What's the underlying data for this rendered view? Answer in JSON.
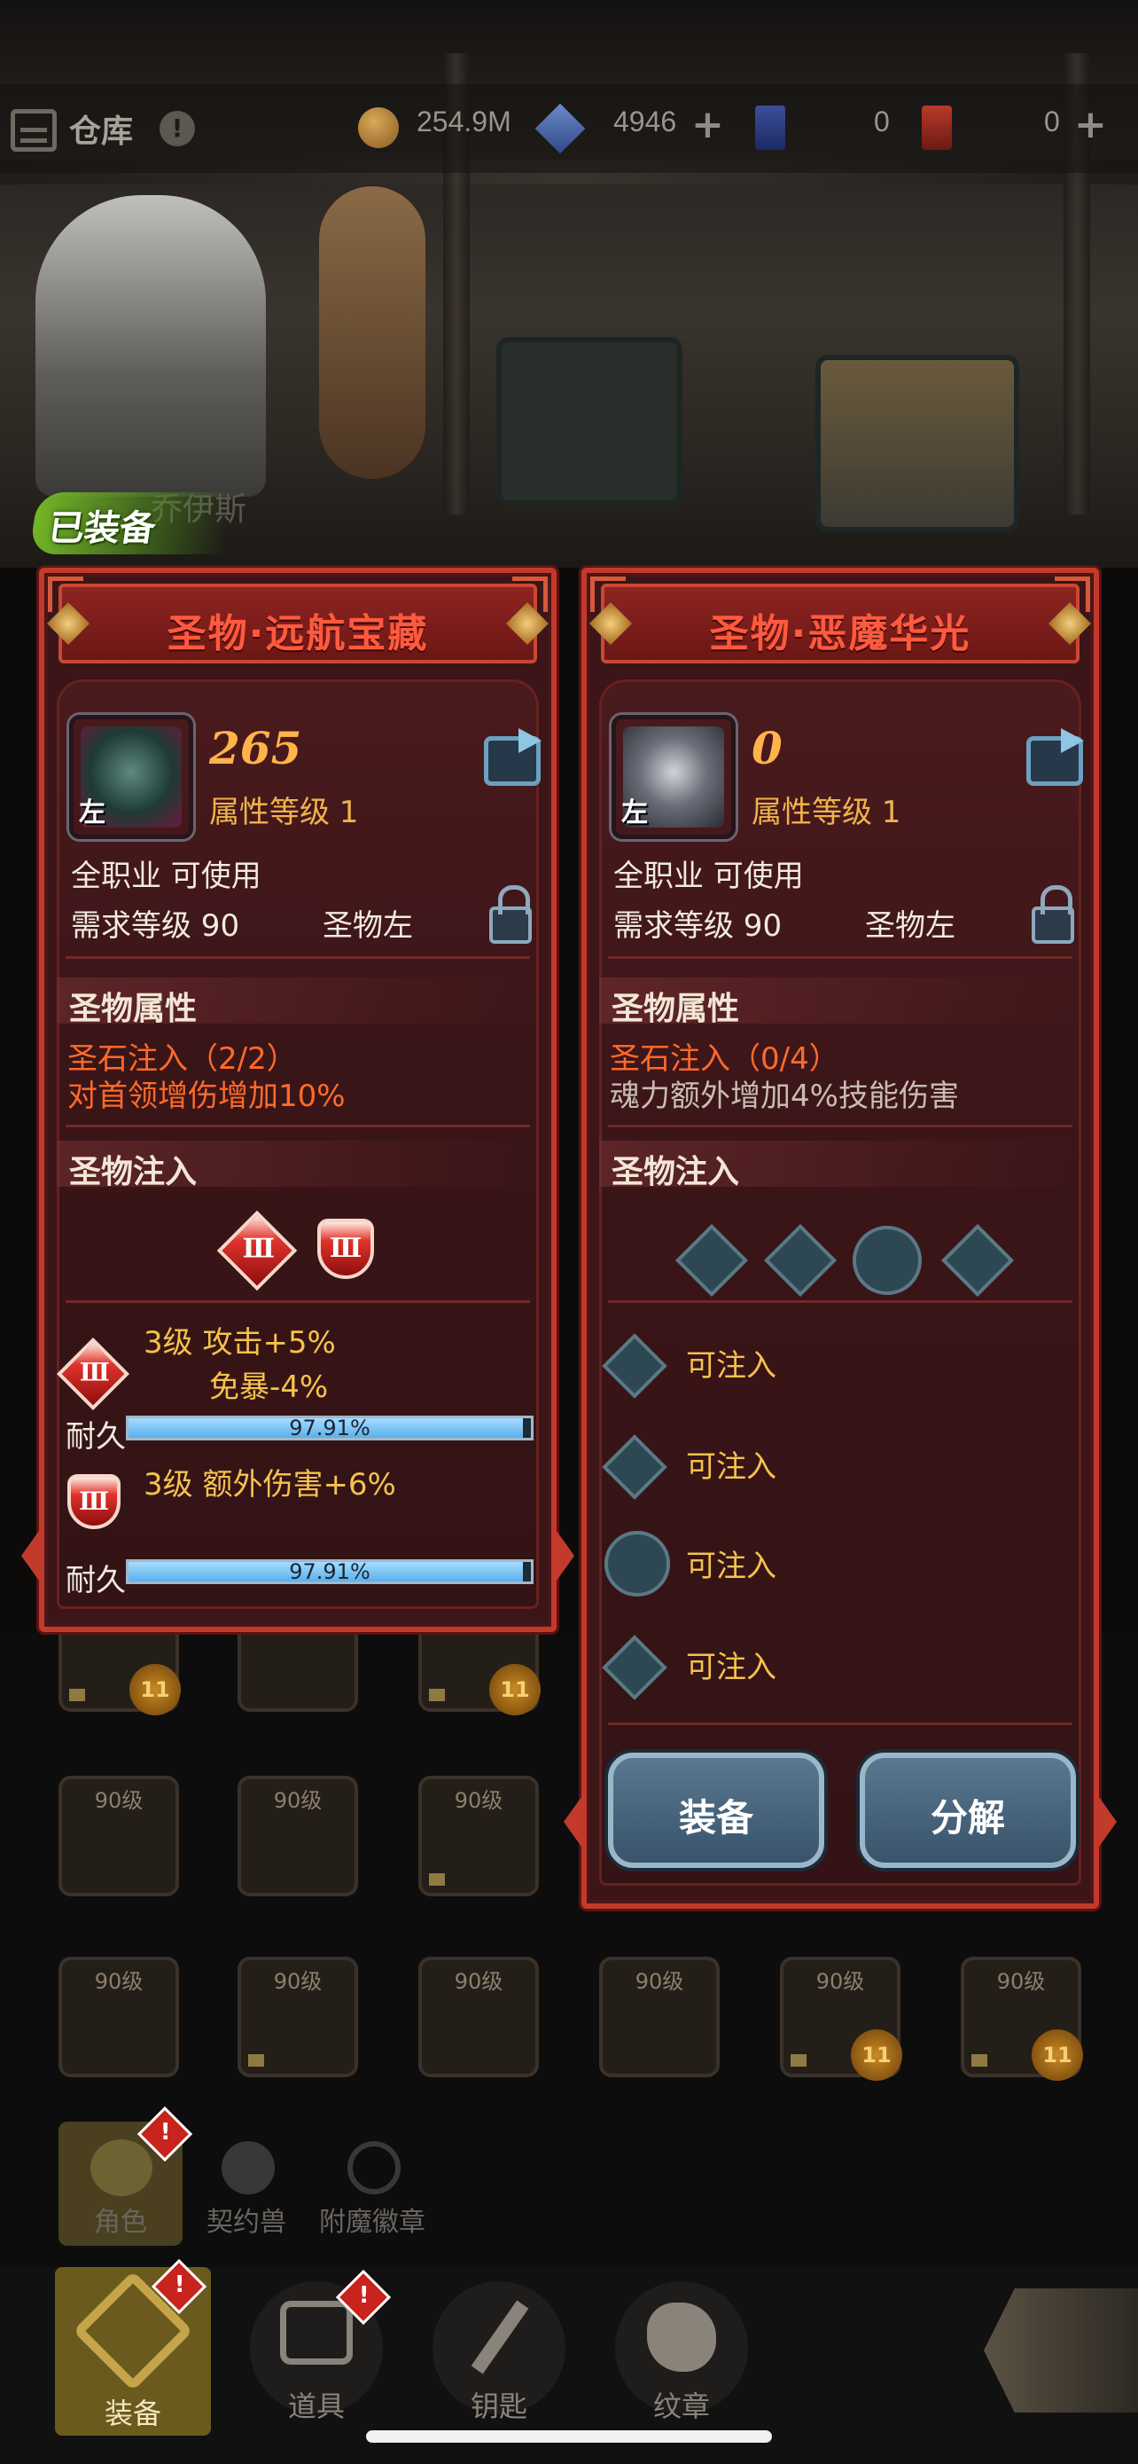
{
  "topbar": {
    "warehouse_label": "仓库",
    "gold": "254.9M",
    "gems": "4946",
    "ticket_a": "0",
    "ticket_b": "0"
  },
  "equipped_tag": "已装备",
  "hero_name": "乔伊斯",
  "left_panel": {
    "title": "圣物·远航宝藏",
    "slot_tag": "左",
    "power": "265",
    "attr_level": "属性等级 1",
    "class_req": "全职业 可使用",
    "level_req": "需求等级 90",
    "slot_type": "圣物左",
    "attr_section": "圣物属性",
    "stone_infusion": "圣石注入（2/2）",
    "bonus": "对首领增伤增加10%",
    "infuse_section": "圣物注入",
    "gem1": {
      "roman": "Ⅲ",
      "line1": "3级  攻击+5%",
      "line2": "免暴-4%"
    },
    "gem2": {
      "roman": "Ⅲ",
      "line1": "3级  额外伤害+6%"
    },
    "durability_label": "耐久",
    "durability1": "97.91%",
    "durability2": "97.91%",
    "durability_value": 0.9791
  },
  "right_panel": {
    "title": "圣物·恶魔华光",
    "slot_tag": "左",
    "power": "0",
    "attr_level": "属性等级 1",
    "class_req": "全职业 可使用",
    "level_req": "需求等级 90",
    "slot_type": "圣物左",
    "attr_section": "圣物属性",
    "stone_infusion": "圣石注入（0/4）",
    "bonus": "魂力额外增加4%技能伤害",
    "infuse_section": "圣物注入",
    "slots": [
      "可注入",
      "可注入",
      "可注入",
      "可注入"
    ],
    "equip_button": "装备",
    "decompose_button": "分解"
  },
  "grid": {
    "level_label": "90级",
    "badge": "11"
  },
  "tabs": [
    "角色",
    "契约兽",
    "附魔徽章"
  ],
  "nav": [
    "装备",
    "道具",
    "钥匙",
    "纹章"
  ],
  "colors": {
    "panel_bg": "#3b1518",
    "panel_border": "#c23a2c",
    "title_text": "#ff5a3e",
    "power_text": "#ffb34a",
    "infusion_text": "#ff6a2a",
    "durability_fill": "#5ab0ec",
    "button_bg": "#4a6880"
  }
}
